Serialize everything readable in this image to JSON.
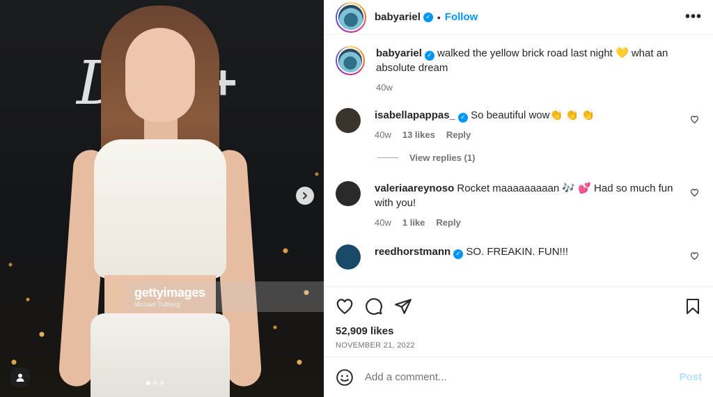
{
  "media": {
    "logo_text": "D",
    "logo_plus": "+",
    "watermark_brand": "gettyimages",
    "watermark_credit": "Michael Tullberg",
    "next_icon": "chevron-right-icon",
    "tag_icon": "user-tag-icon",
    "carousel_dots": 3,
    "carousel_active": 1
  },
  "header": {
    "username": "babyariel",
    "separator": "•",
    "follow_label": "Follow",
    "more_icon": "more-options-icon",
    "more_label": "•••"
  },
  "caption": {
    "username": "babyariel",
    "text": "walked the yellow brick road last night 💛  what an absolute dream",
    "time": "40w"
  },
  "comments": [
    {
      "username": "isabellapappas_",
      "verified": true,
      "text": "So beautiful wow👏 👏 👏",
      "time": "40w",
      "likes": "13 likes",
      "reply_label": "Reply",
      "avatar_color": "#3b342c"
    },
    {
      "username": "valeriaareynoso",
      "verified": false,
      "text": "Rocket maaaaaaaaan 🎶 💕  Had so much fun with you!",
      "time": "40w",
      "likes": "1 like",
      "reply_label": "Reply",
      "avatar_color": "#2a2a2a"
    },
    {
      "username": "reedhorstmann",
      "verified": true,
      "text": "SO. FREAKIN. FUN!!!",
      "avatar_color": "#1a4a6a"
    }
  ],
  "view_replies_label": "View replies (1)",
  "likes_text": "52,909 likes",
  "date_text": "NOVEMBER 21, 2022",
  "add_comment": {
    "placeholder": "Add a comment...",
    "post_label": "Post"
  },
  "colors": {
    "accent": "#0095f6",
    "muted": "#737373",
    "post_disabled": "#b2dffc"
  }
}
